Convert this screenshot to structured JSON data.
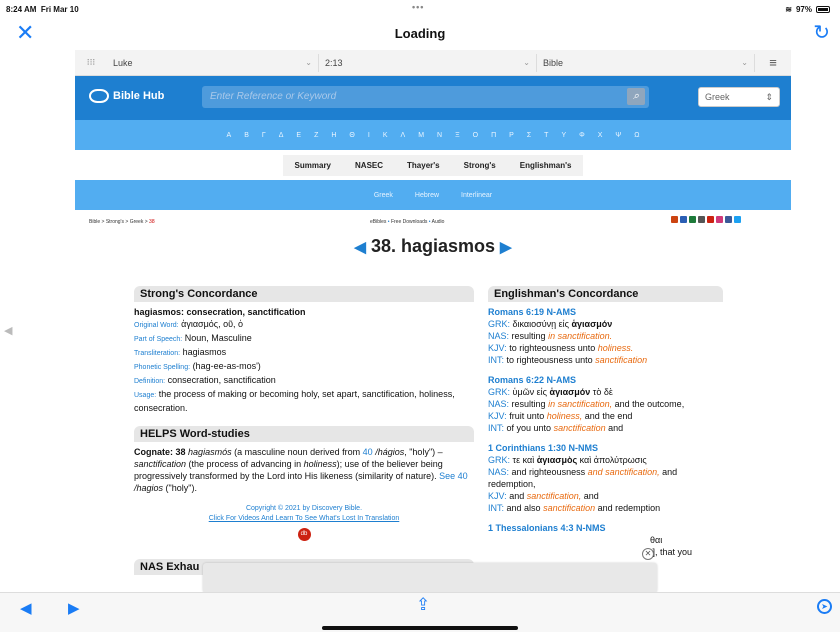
{
  "status": {
    "time": "8:24 AM",
    "date": "Fri Mar 10",
    "battery": "97%"
  },
  "nav": {
    "title": "Loading"
  },
  "selectors": {
    "book": "Luke",
    "verse": "2:13",
    "version": "Bible"
  },
  "header": {
    "logo": "Bible Hub",
    "search_placeholder": "Enter Reference or Keyword",
    "lang": "Greek"
  },
  "alphabet": [
    "Α",
    "Β",
    "Γ",
    "Δ",
    "Ε",
    "Ζ",
    "Η",
    "Θ",
    "Ι",
    "Κ",
    "Λ",
    "Μ",
    "Ν",
    "Ξ",
    "Ο",
    "Π",
    "Ρ",
    "Σ",
    "Τ",
    "Υ",
    "Φ",
    "Χ",
    "Ψ",
    "Ω"
  ],
  "tabs": [
    "Summary",
    "NASEC",
    "Thayer's",
    "Strong's",
    "Englishman's"
  ],
  "tabs2": [
    "Greek",
    "Hebrew",
    "Interlinear"
  ],
  "crumbs": {
    "b1": "Bible",
    "b2": "Strong's",
    "b3": "Greek",
    "cur": "38",
    "mid1": "eBibles",
    "mid2": "Free Downloads",
    "mid3": "Audio"
  },
  "title": {
    "text": "38. hagiasmos"
  },
  "strongs": {
    "head": "Strong's Concordance",
    "word": "hagiasmos: consecration, sanctification",
    "ow_l": "Original Word:",
    "ow": "ἁγιασμός, οῦ, ὁ",
    "ps_l": "Part of Speech:",
    "ps": "Noun, Masculine",
    "tr_l": "Transliteration:",
    "tr": "hagiasmos",
    "ph_l": "Phonetic Spelling:",
    "ph": "(hag-ee-as-mos')",
    "de_l": "Definition:",
    "de": "consecration, sanctification",
    "us_l": "Usage:",
    "us": "the process of making or becoming holy, set apart, sanctification, holiness, consecration."
  },
  "helps": {
    "head": "HELPS Word-studies",
    "cog": "Cognate:",
    "n38": "38",
    "hw": "hagiasmós",
    "p1": "(a masculine noun derived from",
    "n40": "40",
    "hag": "/hágios",
    "p2": ", \"holy\") –",
    "sanc": "sanctification",
    "p3": "(the process of advancing in",
    "hol": "holiness",
    "p4": "); use of the believer being progressively transformed by the Lord into His likeness (similarity of nature).",
    "see": "See 40",
    "hagios": "/hagios",
    "p5": "(\"holy\").",
    "copy": "Copyright © 2021 by Discovery Bible.",
    "click": "Click For Videos And Learn To See What's Lost In Translation"
  },
  "nas_head": "NAS Exhau",
  "englishman": {
    "head": "Englishman's Concordance",
    "e1": {
      "ref": "Romans 6:19 N-AMS",
      "grk_l": "GRK:",
      "grk": "δικαιοσύνῃ εἰς",
      "grk_b": "ἁγιασμόν",
      "nas_l": "NAS:",
      "nas": "resulting",
      "nas_o": "in sanctification.",
      "kjv_l": "KJV:",
      "kjv": "to righteousness unto",
      "kjv_o": "holiness.",
      "int_l": "INT:",
      "int": "to righteousness unto",
      "int_o": "sanctification"
    },
    "e2": {
      "ref": "Romans 6:22 N-AMS",
      "grk_l": "GRK:",
      "grk": "ὑμῶν εἰς",
      "grk_b": "ἁγιασμόν",
      "grk2": "τὸ δὲ",
      "nas_l": "NAS:",
      "nas": "resulting",
      "nas_o": "in sanctification,",
      "nas2": "and the outcome,",
      "kjv_l": "KJV:",
      "kjv": "fruit unto",
      "kjv_o": "holiness,",
      "kjv2": "and the end",
      "int_l": "INT:",
      "int": "of you unto",
      "int_o": "sanctification",
      "int2": "and"
    },
    "e3": {
      "ref": "1 Corinthians 1:30 N-NMS",
      "grk_l": "GRK:",
      "grk": "τε καὶ",
      "grk_b": "ἁγιασμὸς",
      "grk2": "καὶ ἀπολύτρωσις",
      "nas_l": "NAS:",
      "nas": "and righteousness",
      "nas_o": "and sanctification,",
      "nas2": "and redemption,",
      "kjv_l": "KJV:",
      "kjv": "and",
      "kjv_o": "sanctification,",
      "kjv2": "and",
      "int_l": "INT:",
      "int": "and also",
      "int_o": "sanctification",
      "int2": "and redemption"
    },
    "e4": {
      "ref": "1 Thessalonians 4:3 N-NMS",
      "t1": "θαι",
      "t2": "is], that you"
    }
  }
}
